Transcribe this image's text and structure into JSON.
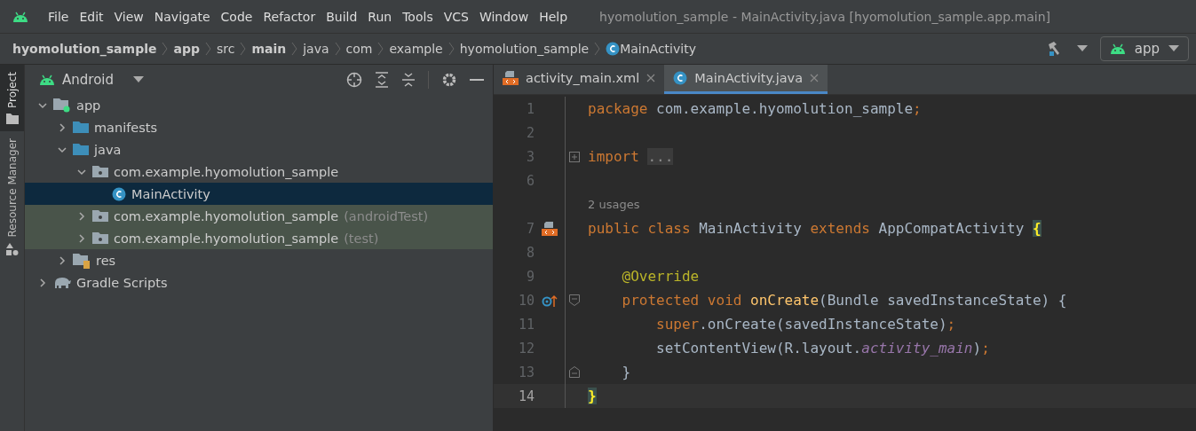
{
  "menu": [
    "File",
    "Edit",
    "View",
    "Navigate",
    "Code",
    "Refactor",
    "Build",
    "Run",
    "Tools",
    "VCS",
    "Window",
    "Help"
  ],
  "window": {
    "title": "hyomolution_sample - MainActivity.java [hyomolution_sample.app.main]"
  },
  "breadcrumb": [
    {
      "label": "hyomolution_sample",
      "bold": true,
      "kind": "segment"
    },
    {
      "label": "app",
      "bold": true,
      "kind": "segment"
    },
    {
      "label": "src",
      "bold": false,
      "kind": "segment"
    },
    {
      "label": "main",
      "bold": true,
      "kind": "segment"
    },
    {
      "label": "java",
      "bold": false,
      "kind": "segment"
    },
    {
      "label": "com",
      "bold": false,
      "kind": "segment"
    },
    {
      "label": "example",
      "bold": false,
      "kind": "segment"
    },
    {
      "label": "hyomolution_sample",
      "bold": false,
      "kind": "segment"
    },
    {
      "label": "MainActivity",
      "bold": false,
      "kind": "class"
    }
  ],
  "run_config": {
    "label": "app"
  },
  "side_stripe": [
    {
      "label": "Project",
      "selected": true
    },
    {
      "label": "Resource Manager",
      "selected": false
    }
  ],
  "project_panel": {
    "view": "Android",
    "tree": [
      {
        "label": "app",
        "kind": "module",
        "expanded": true,
        "selected": false,
        "test_source": false,
        "children": [
          {
            "label": "manifests",
            "kind": "folder",
            "expanded": false,
            "selected": false,
            "test_source": false
          },
          {
            "label": "java",
            "kind": "folder",
            "expanded": true,
            "selected": false,
            "test_source": false,
            "children": [
              {
                "label": "com.example.hyomolution_sample",
                "kind": "package",
                "expanded": true,
                "selected": false,
                "test_source": false,
                "children": [
                  {
                    "label": "MainActivity",
                    "kind": "class",
                    "selected": true
                  }
                ]
              },
              {
                "label": "com.example.hyomolution_sample",
                "suffix": "(androidTest)",
                "kind": "package",
                "expanded": false,
                "selected": false,
                "test_source": true
              },
              {
                "label": "com.example.hyomolution_sample",
                "suffix": "(test)",
                "kind": "package",
                "expanded": false,
                "selected": false,
                "test_source": true
              }
            ]
          },
          {
            "label": "res",
            "kind": "res",
            "expanded": false,
            "selected": false,
            "test_source": false
          }
        ]
      },
      {
        "label": "Gradle Scripts",
        "kind": "gradle",
        "expanded": false,
        "selected": false,
        "test_source": false
      }
    ]
  },
  "tabs": [
    {
      "label": "activity_main.xml",
      "kind": "layout",
      "selected": false
    },
    {
      "label": "MainActivity.java",
      "kind": "class",
      "selected": true
    }
  ],
  "editor": {
    "lines": [
      {
        "kind": "code",
        "number": "1",
        "current": false,
        "tokens": [
          {
            "kind": "kw",
            "s": "package"
          },
          {
            "kind": "plain",
            "s": " com.example.hyomolution_sample"
          },
          {
            "kind": "kw",
            "s": ";"
          }
        ]
      },
      {
        "kind": "code",
        "number": "2",
        "current": false
      },
      {
        "kind": "code",
        "number": "3",
        "current": false,
        "fold": {
          "kind": "expand"
        },
        "tokens": [
          {
            "kind": "kw",
            "s": "import "
          },
          {
            "kind": "folded",
            "s": "..."
          }
        ]
      },
      {
        "kind": "code",
        "number": "6",
        "current": false
      },
      {
        "kind": "usages",
        "text": "2 usages"
      },
      {
        "kind": "code",
        "number": "7",
        "current": false,
        "gutter": {
          "kind": "layout"
        },
        "tokens": [
          {
            "kind": "kw",
            "s": "public class "
          },
          {
            "kind": "plain",
            "s": "MainActivity "
          },
          {
            "kind": "kw",
            "s": "extends "
          },
          {
            "kind": "plain",
            "s": "AppCompatActivity "
          },
          {
            "kind": "match",
            "s": "{"
          }
        ]
      },
      {
        "kind": "code",
        "number": "8",
        "current": false
      },
      {
        "kind": "code",
        "number": "9",
        "current": false,
        "tokens": [
          {
            "kind": "ann",
            "s": "    @Override"
          }
        ]
      },
      {
        "kind": "code",
        "number": "10",
        "current": false,
        "gutter": {
          "kind": "override"
        },
        "fold": {
          "kind": "start"
        },
        "tokens": [
          {
            "kind": "kw",
            "s": "    protected void "
          },
          {
            "kind": "fn",
            "s": "onCreate"
          },
          {
            "kind": "plain",
            "s": "(Bundle savedInstanceState) {"
          }
        ]
      },
      {
        "kind": "code",
        "number": "11",
        "current": false,
        "tokens": [
          {
            "kind": "kw",
            "s": "        super"
          },
          {
            "kind": "plain",
            "s": ".onCreate(savedInstanceState)"
          },
          {
            "kind": "kw",
            "s": ";"
          }
        ]
      },
      {
        "kind": "code",
        "number": "12",
        "current": false,
        "tokens": [
          {
            "kind": "plain",
            "s": "        setContentView(R.layout."
          },
          {
            "kind": "field",
            "s": "activity_main"
          },
          {
            "kind": "plain",
            "s": ")"
          },
          {
            "kind": "kw",
            "s": ";"
          }
        ]
      },
      {
        "kind": "code",
        "number": "13",
        "current": false,
        "fold": {
          "kind": "end"
        },
        "tokens": [
          {
            "kind": "plain",
            "s": "    }"
          }
        ]
      },
      {
        "kind": "code",
        "number": "14",
        "current": true,
        "tokens": [
          {
            "kind": "match",
            "s": "}"
          }
        ]
      }
    ]
  }
}
